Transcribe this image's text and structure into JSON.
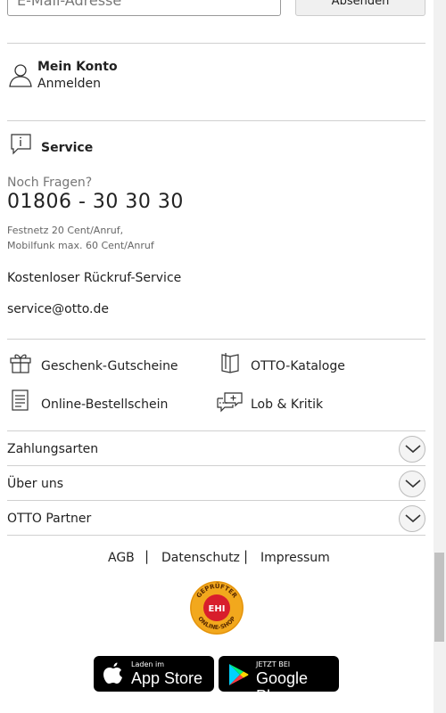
{
  "newsletter": {
    "email_placeholder": "E-Mail-Adresse",
    "submit_label": "Absenden"
  },
  "account": {
    "title": "Mein Konto",
    "login": "Anmelden"
  },
  "service": {
    "title": "Service",
    "question": "Noch Fragen?",
    "phone": "01806 - 30 30 30",
    "cost_line1": "Festnetz 20 Cent/Anruf,",
    "cost_line2": "Mobilfunk max. 60 Cent/Anruf",
    "callback": "Kostenloser Rückruf-Service",
    "email": "service@otto.de"
  },
  "quick_links": [
    {
      "label": "Geschenk-Gutscheine",
      "icon": "gift-icon"
    },
    {
      "label": "OTTO-Kataloge",
      "icon": "catalog-icon"
    },
    {
      "label": "Online-Bestellschein",
      "icon": "order-form-icon"
    },
    {
      "label": "Lob & Kritik",
      "icon": "feedback-icon"
    }
  ],
  "accordion": [
    {
      "label": "Zahlungsarten"
    },
    {
      "label": "Über uns"
    },
    {
      "label": "OTTO Partner"
    }
  ],
  "legal": {
    "agb": "AGB",
    "privacy": "Datenschutz",
    "imprint": "Impressum",
    "separator": "|"
  },
  "seal": {
    "top_text": "GEPRÜFTER",
    "center_text": "EHI",
    "bottom_text": "ONLINE-SHOP",
    "color": "#f2a81d",
    "center_color": "#d81e2c"
  },
  "app_badges": {
    "appstore_small": "Laden im",
    "appstore_big": "App Store",
    "google_small": "JETZT BEI",
    "google_big": "Google Play"
  }
}
